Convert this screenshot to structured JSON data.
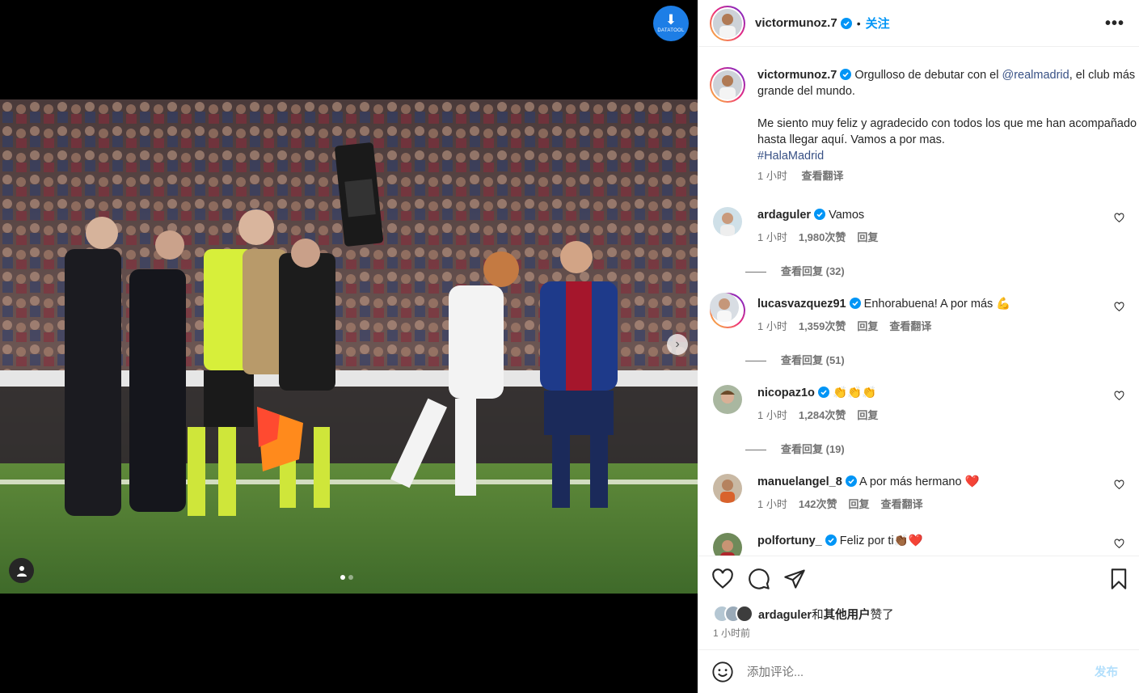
{
  "header": {
    "username": "victormunoz.7",
    "separator": "•",
    "follow_label": "关注",
    "more_label": "•••"
  },
  "media": {
    "badge_label": "DATATOOL",
    "slides_total": 2,
    "slide_active": 1
  },
  "caption": {
    "username": "victormunoz.7",
    "text_before_mention": "Orgulloso de debutar con el ",
    "mention": "@realmadrid",
    "text_after_mention": ", el club más grande del mundo.",
    "paragraph2": "Me siento muy feliz y agradecido con todos los que me han acompañado hasta llegar aquí. Vamos a por mas.",
    "hashtag": "#HalaMadrid",
    "time": "1 小时",
    "translate_label": "查看翻译"
  },
  "comments": [
    {
      "username": "ardaguler",
      "text": "Vamos",
      "emoji": "",
      "time": "1 小时",
      "likes": "1,980次赞",
      "reply_label": "回复",
      "translate_label": "",
      "view_replies": "查看回复 (32)"
    },
    {
      "username": "lucasvazquez91",
      "text": "Enhorabuena! A por más",
      "emoji": "💪",
      "time": "1 小时",
      "likes": "1,359次赞",
      "reply_label": "回复",
      "translate_label": "查看翻译",
      "view_replies": "查看回复 (51)"
    },
    {
      "username": "nicopaz1o",
      "text": "",
      "emoji": "👏👏👏",
      "time": "1 小时",
      "likes": "1,284次赞",
      "reply_label": "回复",
      "translate_label": "",
      "view_replies": "查看回复 (19)"
    },
    {
      "username": "manuelangel_8",
      "text": "A por más hermano",
      "emoji": "❤️",
      "time": "1 小时",
      "likes": "142次赞",
      "reply_label": "回复",
      "translate_label": "查看翻译",
      "view_replies": ""
    },
    {
      "username": "polfortuny_",
      "text": "Feliz por ti",
      "emoji": "👏🏾❤️",
      "time": "",
      "likes": "",
      "reply_label": "",
      "translate_label": "",
      "view_replies": ""
    }
  ],
  "likes_line": {
    "user": "ardaguler",
    "suffix": "和",
    "others": "其他用户",
    "action": "赞了"
  },
  "post_time": "1 小时前",
  "add_comment": {
    "placeholder": "添加评论...",
    "post_label": "发布"
  },
  "colors": {
    "accent": "#0095f6",
    "verified": "#0095f6",
    "link": "#385185",
    "post_disabled": "#b2dffc"
  }
}
